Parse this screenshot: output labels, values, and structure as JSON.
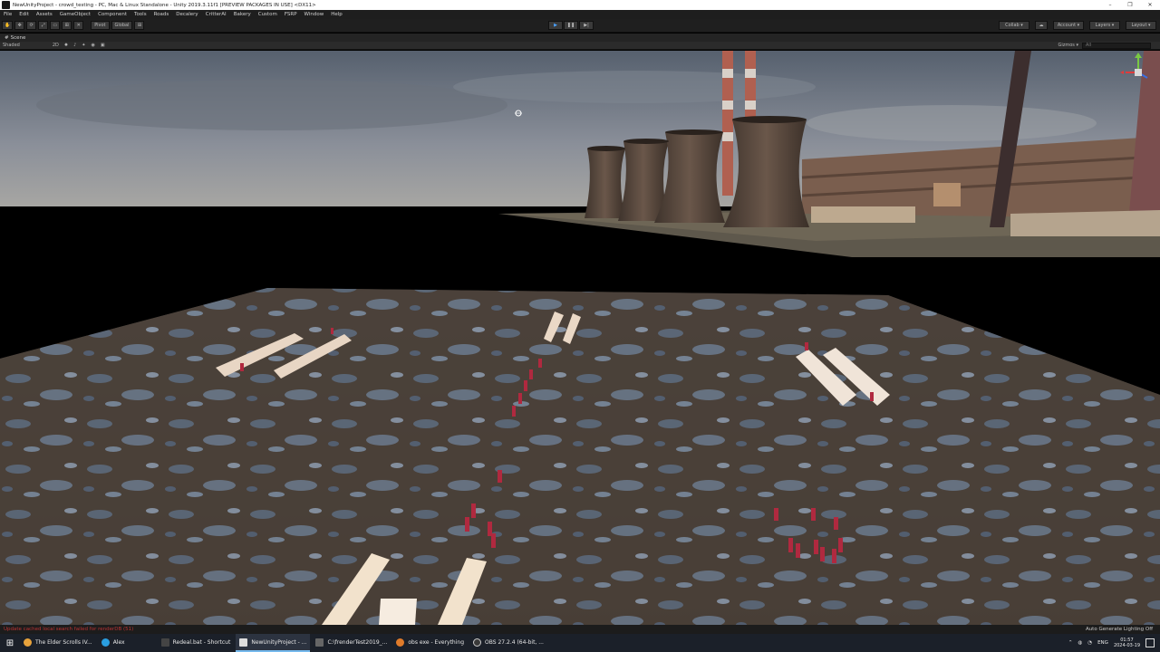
{
  "window": {
    "title": "NewUnityProject - crowd_testing - PC, Mac & Linux Standalone - Unity 2019.3.11f1 [PREVIEW PACKAGES IN USE] <DX11>",
    "controls": [
      "–",
      "❐",
      "✕"
    ]
  },
  "menu": [
    "File",
    "Edit",
    "Assets",
    "GameObject",
    "Component",
    "Tools",
    "Roads",
    "Decalery",
    "CritterAI",
    "Bakery",
    "Custom",
    "FSRP",
    "Window",
    "Help"
  ],
  "toolbar": {
    "tools": [
      "✋",
      "✥",
      "⟳",
      "⤢",
      "▭",
      "⊞",
      "✕"
    ],
    "pivot": "Pivot",
    "global": "Global",
    "grid": "⊞",
    "play": "▶",
    "pause": "❚❚",
    "step": "▶|",
    "collab": "Collab ▾",
    "cloud": "☁",
    "account": "Account ▾",
    "layers": "Layers ▾",
    "layout": "Layout ▾"
  },
  "scene_tab": {
    "label": "Scene",
    "shading": "Shaded",
    "mode_2d": "2D",
    "gizmos": "Gizmos ▾",
    "search_placeholder": "All"
  },
  "status": {
    "error": "Update cached local search failed for renderDB (51)",
    "lighting": "Auto Generate Lighting Off"
  },
  "taskbar": {
    "apps": [
      {
        "label": "The Elder Scrolls IV...",
        "color": "#e8a33c",
        "active": false
      },
      {
        "label": "Alex",
        "color": "#2a9ee0",
        "active": false
      },
      {
        "label": "Redeal.bat - Shortcut",
        "color": "#444",
        "active": false
      },
      {
        "label": "NewUnityProject - ...",
        "color": "#ddd",
        "active": true
      },
      {
        "label": "C:\\frenderTest2019_...",
        "color": "#666",
        "active": false
      },
      {
        "label": "obs exe - Everything",
        "color": "#e07b2a",
        "active": false
      },
      {
        "label": "OBS 27.2.4 (64-bit, ...",
        "color": "#3a3a3a",
        "active": false
      }
    ],
    "lang": "ENG",
    "time": "01:57",
    "date": "2024-03-19"
  }
}
